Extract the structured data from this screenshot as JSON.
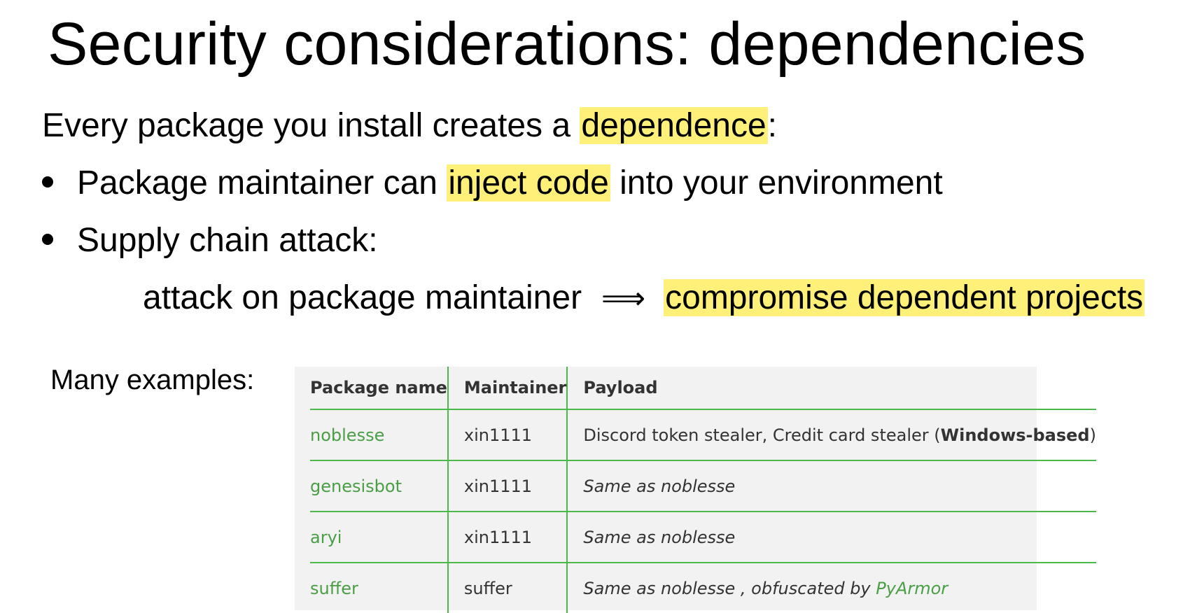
{
  "slide": {
    "title": "Security considerations:  dependencies",
    "intro": {
      "before": "Every package you install creates a ",
      "highlight": "dependence",
      "after": ":"
    },
    "bullets": [
      {
        "before": "Package maintainer can ",
        "highlight": "inject code",
        "after": " into your environment"
      },
      {
        "text": "Supply chain attack:"
      }
    ],
    "attack_line": {
      "before": "attack on package maintainer",
      "arrow": "⟹",
      "highlight": "compromise dependent projects"
    },
    "examples_label": "Many examples:"
  },
  "table": {
    "headers": [
      "Package name",
      "Maintainer",
      "Payload"
    ],
    "rows": [
      {
        "package": "noblesse",
        "maintainer": "xin1111",
        "payload_text": "Discord token stealer, Credit card stealer (",
        "payload_bold": "Windows-based",
        "payload_end": ")"
      },
      {
        "package": "genesisbot",
        "maintainer": "xin1111",
        "payload_italic": "Same as noblesse"
      },
      {
        "package": "aryi",
        "maintainer": "xin1111",
        "payload_italic": "Same as noblesse"
      },
      {
        "package": "suffer",
        "maintainer": "suffer",
        "payload_italic": "Same as noblesse , obfuscated by ",
        "payload_link": "PyArmor"
      }
    ]
  },
  "colors": {
    "highlight": "#fff07a",
    "table_accent": "#4cb848",
    "table_bg": "#f2f2f2"
  }
}
